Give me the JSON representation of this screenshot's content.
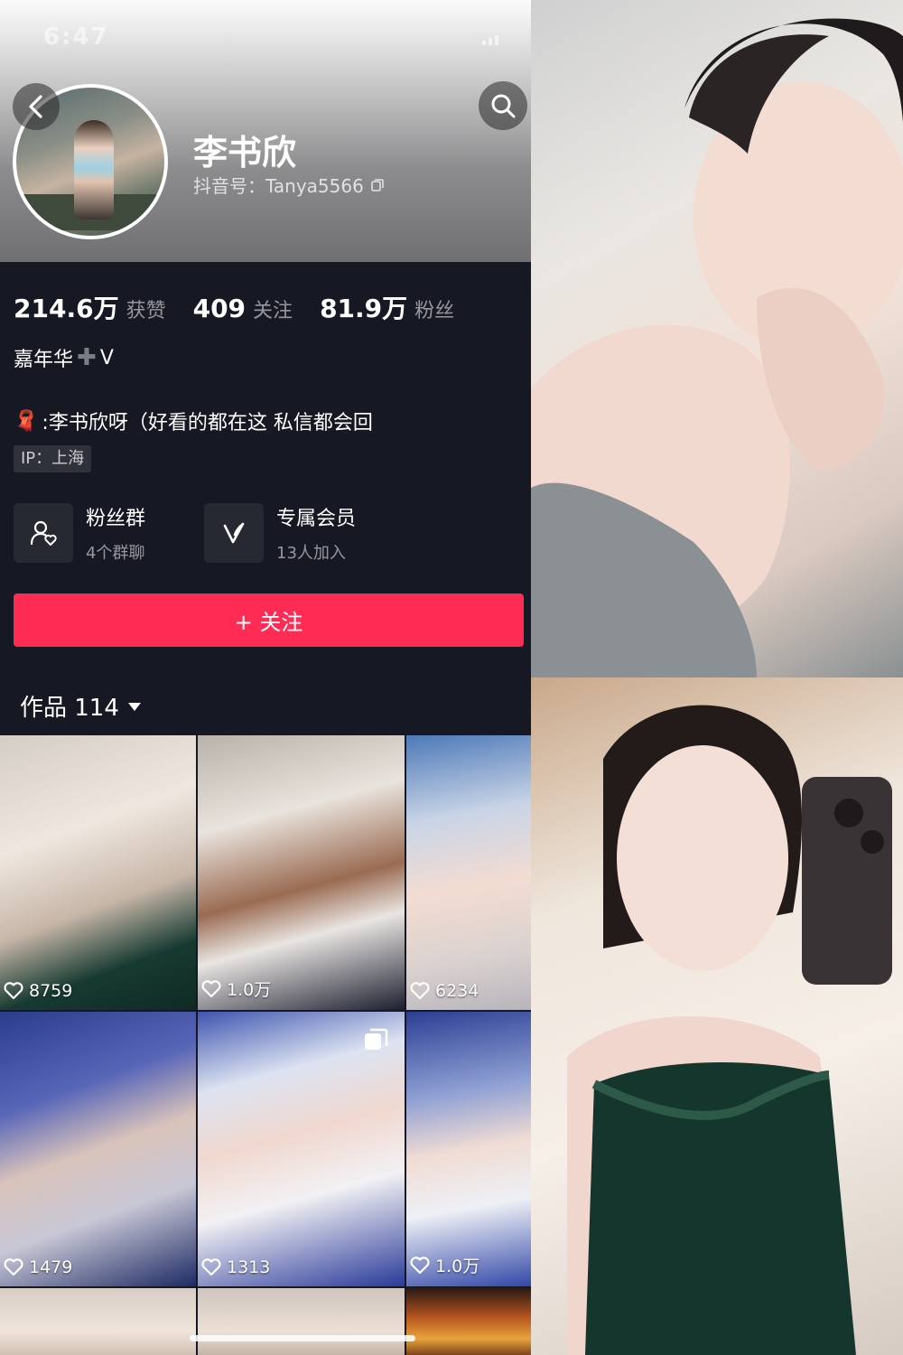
{
  "status": {
    "time": "6:47"
  },
  "profile": {
    "name": "李书欣",
    "douyin_id": "抖音号：Tanya5566"
  },
  "stats": [
    {
      "value": "214.6万",
      "label": "获赞"
    },
    {
      "value": "409",
      "label": "关注"
    },
    {
      "value": "81.9万",
      "label": "粉丝"
    }
  ],
  "tag": {
    "left": "嘉年华",
    "right": "V"
  },
  "bio": {
    "emoji": "🧣",
    "text": ":李书欣呀（好看的都在这 私信都会回"
  },
  "ip": "IP：上海",
  "features": [
    {
      "title": "粉丝群",
      "subtitle": "4个群聊",
      "icon": "fan-group-icon"
    },
    {
      "title": "专属会员",
      "subtitle": "13人加入",
      "icon": "vip-v-icon"
    }
  ],
  "follow_button": "+ 关注",
  "works": {
    "label": "作品 114"
  },
  "videos": [
    {
      "likes": "8759"
    },
    {
      "likes": "1.0万"
    },
    {
      "likes": "6234"
    },
    {
      "likes": "1479"
    },
    {
      "likes": "1313"
    },
    {
      "likes": "1.0万"
    }
  ],
  "colors": {
    "accent": "#fe2c55",
    "background": "#161823"
  }
}
